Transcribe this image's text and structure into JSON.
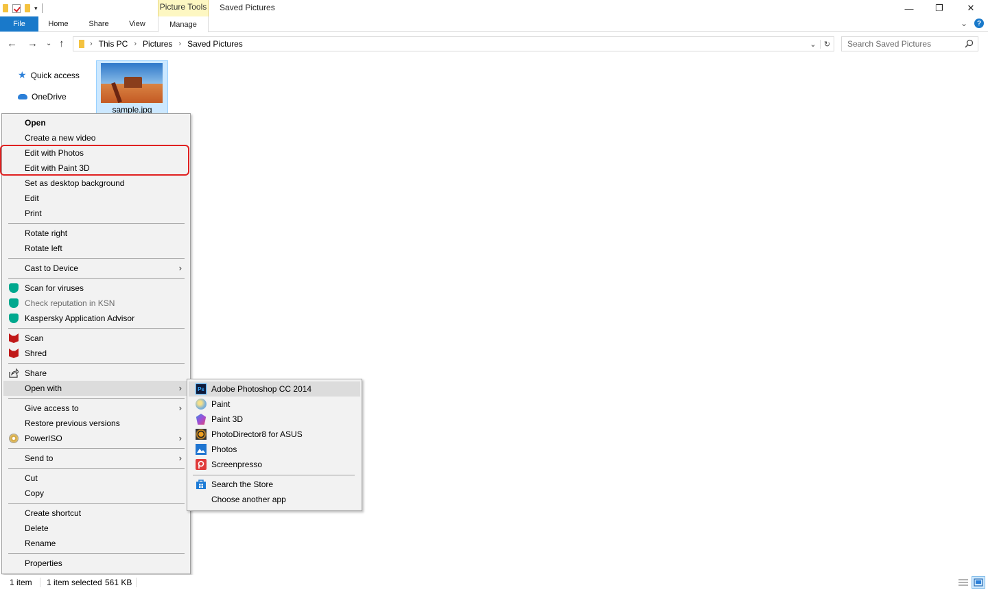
{
  "titlebar": {
    "context_tab": "Picture Tools",
    "title": "Saved Pictures",
    "minimize_glyph": "—",
    "restore_glyph": "❐",
    "close_glyph": "✕",
    "qat_dropdown_glyph": "▾"
  },
  "ribbon": {
    "tabs": [
      "File",
      "Home",
      "Share",
      "View",
      "Manage"
    ],
    "collapse_glyph": "⌄",
    "help_glyph": "?"
  },
  "nav": {
    "back_glyph": "←",
    "forward_glyph": "→",
    "recent_glyph": "⌄",
    "up_glyph": "↑",
    "breadcrumb": [
      "This PC",
      "Pictures",
      "Saved Pictures"
    ],
    "crumb_sep": "›",
    "dropdown_glyph": "⌄",
    "refresh_glyph": "↻",
    "search_placeholder": "Search Saved Pictures"
  },
  "navpane": {
    "items": [
      "Quick access",
      "OneDrive"
    ],
    "star_glyph": "★"
  },
  "file": {
    "name": "sample.jpg"
  },
  "context_menu": {
    "items": [
      "Open",
      "Create a new video",
      "Edit with Photos",
      "Edit with Paint 3D",
      "Set as desktop background",
      "Edit",
      "Print",
      "Rotate right",
      "Rotate left",
      "Cast to Device",
      "Scan for viruses",
      "Check reputation in KSN",
      "Kaspersky Application Advisor",
      "Scan",
      "Shred",
      "Share",
      "Open with",
      "Give access to",
      "Restore previous versions",
      "PowerISO",
      "Send to",
      "Cut",
      "Copy",
      "Create shortcut",
      "Delete",
      "Rename",
      "Properties"
    ],
    "submenu_arrow": "›",
    "highlight_color": "#e02020"
  },
  "open_with": {
    "items": [
      "Adobe Photoshop CC 2014",
      "Paint",
      "Paint 3D",
      "PhotoDirector8 for ASUS",
      "Photos",
      "Screenpresso",
      "Search the Store",
      "Choose another app"
    ],
    "ps_label": "Ps"
  },
  "statusbar": {
    "item_count": "1 item",
    "selected": "1 item selected",
    "size": "561 KB"
  }
}
